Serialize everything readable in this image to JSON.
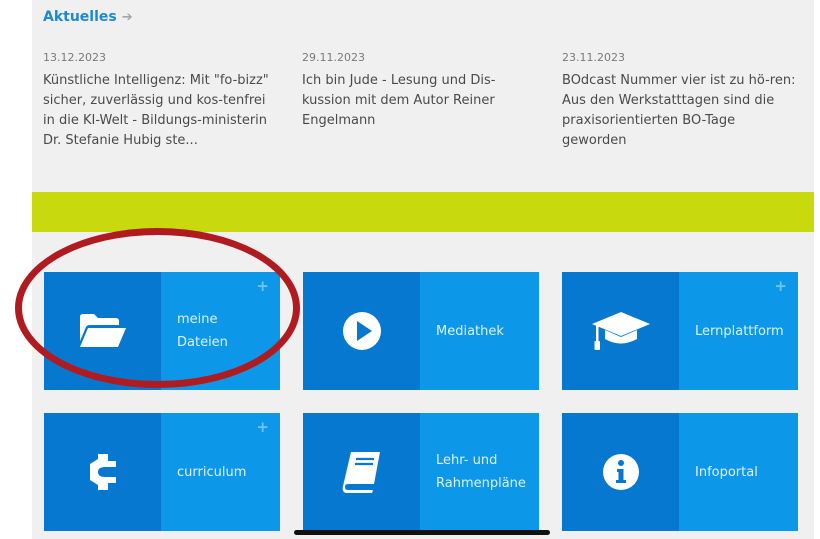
{
  "news": {
    "heading": "Aktuelles",
    "items": [
      {
        "date": "13.12.2023",
        "text": "Künstliche Intelligenz: Mit \"fo-bizz\" sicher, zuverlässig und kos-tenfrei in die KI-Welt - Bildungs-ministerin Dr. Stefanie Hubig ste..."
      },
      {
        "date": "29.11.2023",
        "text": "Ich bin Jude - Lesung und Dis-kussion mit dem Autor Reiner Engelmann"
      },
      {
        "date": "23.11.2023",
        "text": "BOdcast Nummer vier ist zu hö-ren: Aus den Werkstatttagen sind die praxisorientierten BO-Tage geworden"
      }
    ]
  },
  "tiles": [
    {
      "label": "meine\nDateien",
      "icon": "folder-open-icon",
      "plus": "+"
    },
    {
      "label": "Mediathek",
      "icon": "play-circle-icon",
      "plus": ""
    },
    {
      "label": "Lernplattform",
      "icon": "graduation-cap-icon",
      "plus": "+"
    },
    {
      "label": "curriculum",
      "icon": "curriculum-c-icon",
      "plus": "+"
    },
    {
      "label": "Lehr- und\nRahmenpläne",
      "icon": "book-icon",
      "plus": ""
    },
    {
      "label": "Infoportal",
      "icon": "info-circle-icon",
      "plus": ""
    }
  ],
  "colors": {
    "accent_bar": "#c8d90e",
    "tile": "#0d97e8",
    "tile_icon_area": "#0778cf",
    "link": "#1a8ad4",
    "annotation_circle": "#b01b1f"
  }
}
